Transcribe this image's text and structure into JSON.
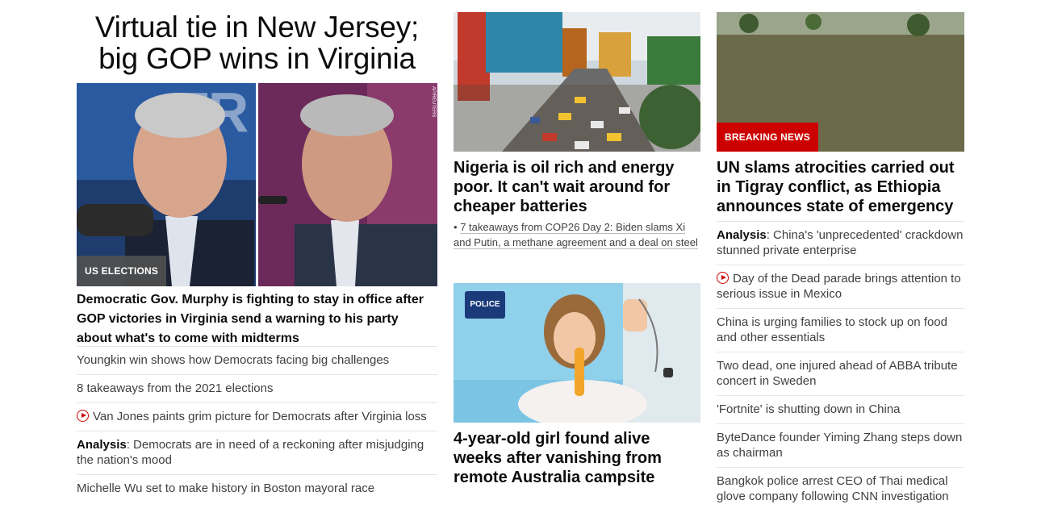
{
  "column_one": {
    "top_headline": "Virtual tie in New Jersey; big GOP wins in Virginia",
    "image_badge": "US ELECTIONS",
    "image_credit": "AP/REUTERS",
    "lead_headline": "Democratic Gov. Murphy is fighting to stay in office after GOP victories in Virginia send a warning to his party about what's to come with midterms",
    "links": [
      {
        "prefix": "",
        "text": "Youngkin win shows how Democrats facing big challenges"
      },
      {
        "prefix": "",
        "text": "8 takeaways from the 2021 elections"
      },
      {
        "prefix": "",
        "text": "Van Jones paints grim picture for Democrats after Virginia loss"
      },
      {
        "prefix": "Analysis",
        "text": ": Democrats are in need of a reckoning after misjudging the nation's mood"
      },
      {
        "prefix": "",
        "text": "Michelle Wu set to make history in Boston mayoral race"
      }
    ]
  },
  "column_two": {
    "story_one_headline": "Nigeria is oil rich and energy poor. It can't wait around for cheaper batteries",
    "story_one_sublink": "7 takeaways from COP26 Day 2: Biden slams Xi and Putin, a methane agreement and a deal on steel",
    "story_one_bullet": "•",
    "police_badge": "POLICE",
    "story_two_headline": "4-year-old girl found alive weeks after vanishing from remote Australia campsite"
  },
  "column_three": {
    "image_badge": "BREAKING NEWS",
    "headline": "UN slams atrocities carried out in Tigray conflict, as Ethiopia announces state of emergency",
    "links": [
      {
        "prefix": "Analysis",
        "text": ": China's 'unprecedented' crackdown stunned private enterprise"
      },
      {
        "prefix": "",
        "text": "Day of the Dead parade brings attention to serious issue in Mexico"
      },
      {
        "prefix": "",
        "text": "China is urging families to stock up on food and other essentials"
      },
      {
        "prefix": "",
        "text": "Two dead, one injured ahead of ABBA tribute concert in Sweden"
      },
      {
        "prefix": "",
        "text": "'Fortnite' is shutting down in China"
      },
      {
        "prefix": "",
        "text": "ByteDance founder Yiming Zhang steps down as chairman"
      },
      {
        "prefix": "",
        "text": "Bangkok police arrest CEO of Thai medical glove company following CNN investigation"
      }
    ]
  },
  "icons": {
    "video": "play-circle-icon"
  },
  "colors": {
    "breaking_red": "#cc0000",
    "badge_gray": "#505050",
    "headline_text": "#0c0c0c",
    "link_text": "#404040"
  }
}
